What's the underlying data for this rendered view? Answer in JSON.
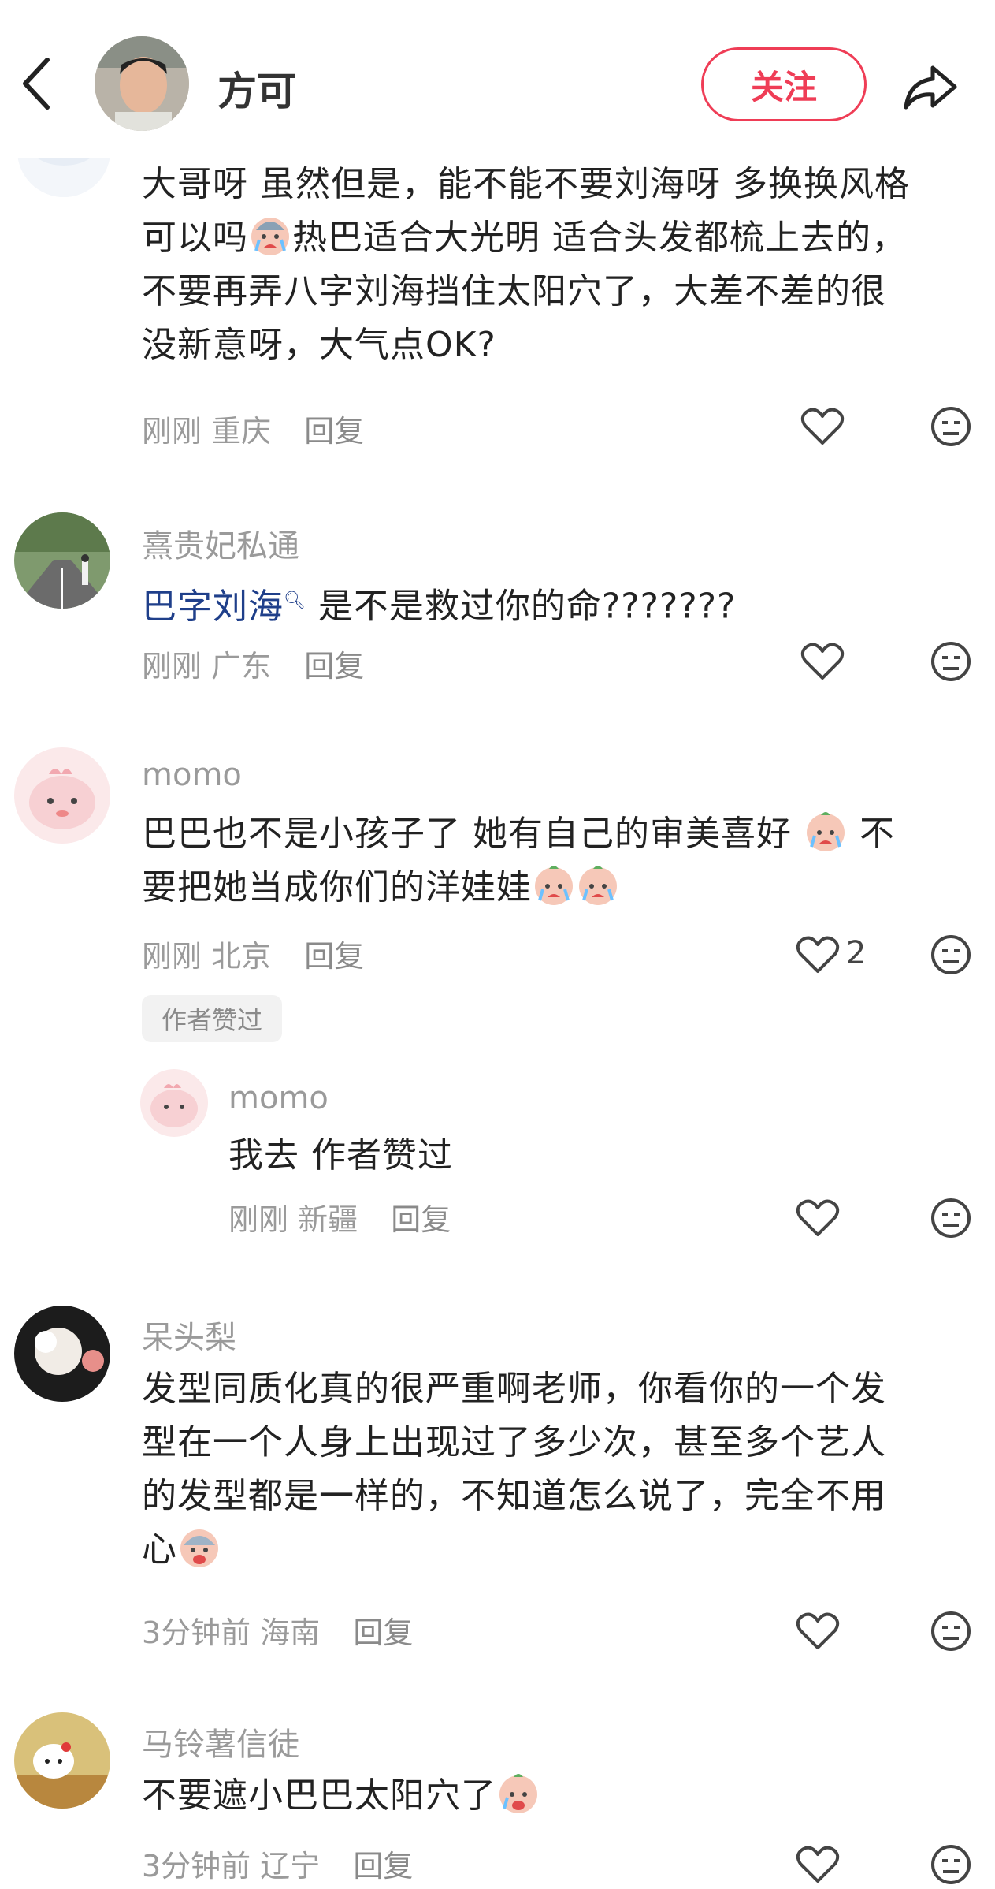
{
  "header": {
    "author_name": "方可",
    "follow_label": "关注"
  },
  "comments": [
    {
      "text_parts": [
        "大哥呀  虽然但是，能不能不要刘海呀 多换换风格",
        "可以吗",
        "热巴适合大光明 适合头发都梳上去的，",
        "不要再弄八字刘海挡住太阳穴了，大差不差的很",
        "没新意呀，大气点OK?"
      ],
      "time": "刚刚",
      "location": "重庆",
      "reply_label": "回复"
    },
    {
      "username": "熹贵妃私通",
      "topic": "巴字刘海",
      "text": "是不是救过你的命???????",
      "time": "刚刚",
      "location": "广东",
      "reply_label": "回复"
    },
    {
      "username": "momo",
      "line1_a": "巴巴也不是小孩子了 她有自己的审美喜好",
      "line1_b": "不",
      "line2": "要把她当成你们的洋娃娃",
      "time": "刚刚",
      "location": "北京",
      "reply_label": "回复",
      "likes": "2",
      "author_liked": "作者赞过"
    },
    {
      "username": "momo",
      "text": "我去 作者赞过",
      "time": "刚刚",
      "location": "新疆",
      "reply_label": "回复"
    },
    {
      "username": "呆头梨",
      "lines": [
        "发型同质化真的很严重啊老师，你看你的一个发",
        "型在一个人身上出现过了多少次，甚至多个艺人",
        "的发型都是一样的，不知道怎么说了，完全不用",
        "心"
      ],
      "time": "3分钟前",
      "location": "海南",
      "reply_label": "回复"
    },
    {
      "username": "马铃薯信徒",
      "text": "不要遮小巴巴太阳穴了",
      "time": "3分钟前",
      "location": "辽宁",
      "reply_label": "回复"
    }
  ],
  "colors": {
    "accent": "#ef3d56",
    "meta": "#9a9a9a",
    "link": "#1f3f8a"
  },
  "icons": [
    "back-arrow-icon",
    "share-icon",
    "heart-icon",
    "dislike-face-icon",
    "crying-emoji-icon",
    "search-icon"
  ]
}
